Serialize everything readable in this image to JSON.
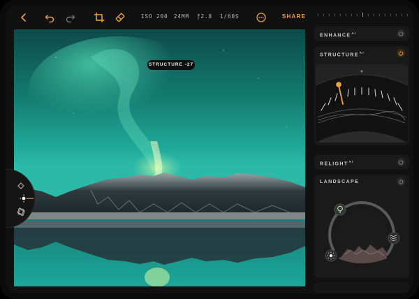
{
  "toolbar": {
    "iso": "ISO 200",
    "focal": "24MM",
    "aperture": "ƒ2.8",
    "shutter": "1/60S",
    "share_label": "SHARE"
  },
  "photo": {
    "overlay_label": "STRUCTURE -27"
  },
  "panel": {
    "enhance": {
      "label": "ENHANCE",
      "sup": "AI",
      "enabled": false
    },
    "structure": {
      "label": "STRUCTURE",
      "sup": "AI",
      "enabled": true,
      "value": -27
    },
    "relight": {
      "label": "RELIGHT",
      "sup": "AI",
      "enabled": false
    },
    "landscape": {
      "label": "LANDSCAPE",
      "enabled": false
    }
  },
  "colors": {
    "accent": "#f2a23a",
    "panel_bg": "#1a1a1a",
    "text": "#c9c9c9"
  },
  "icons": [
    "back-icon",
    "undo-icon",
    "redo-icon",
    "crop-icon",
    "eraser-icon",
    "more-icon",
    "power-icon",
    "sun-icon",
    "tree-icon",
    "water-icon",
    "mountain-icon",
    "layers-icon"
  ]
}
